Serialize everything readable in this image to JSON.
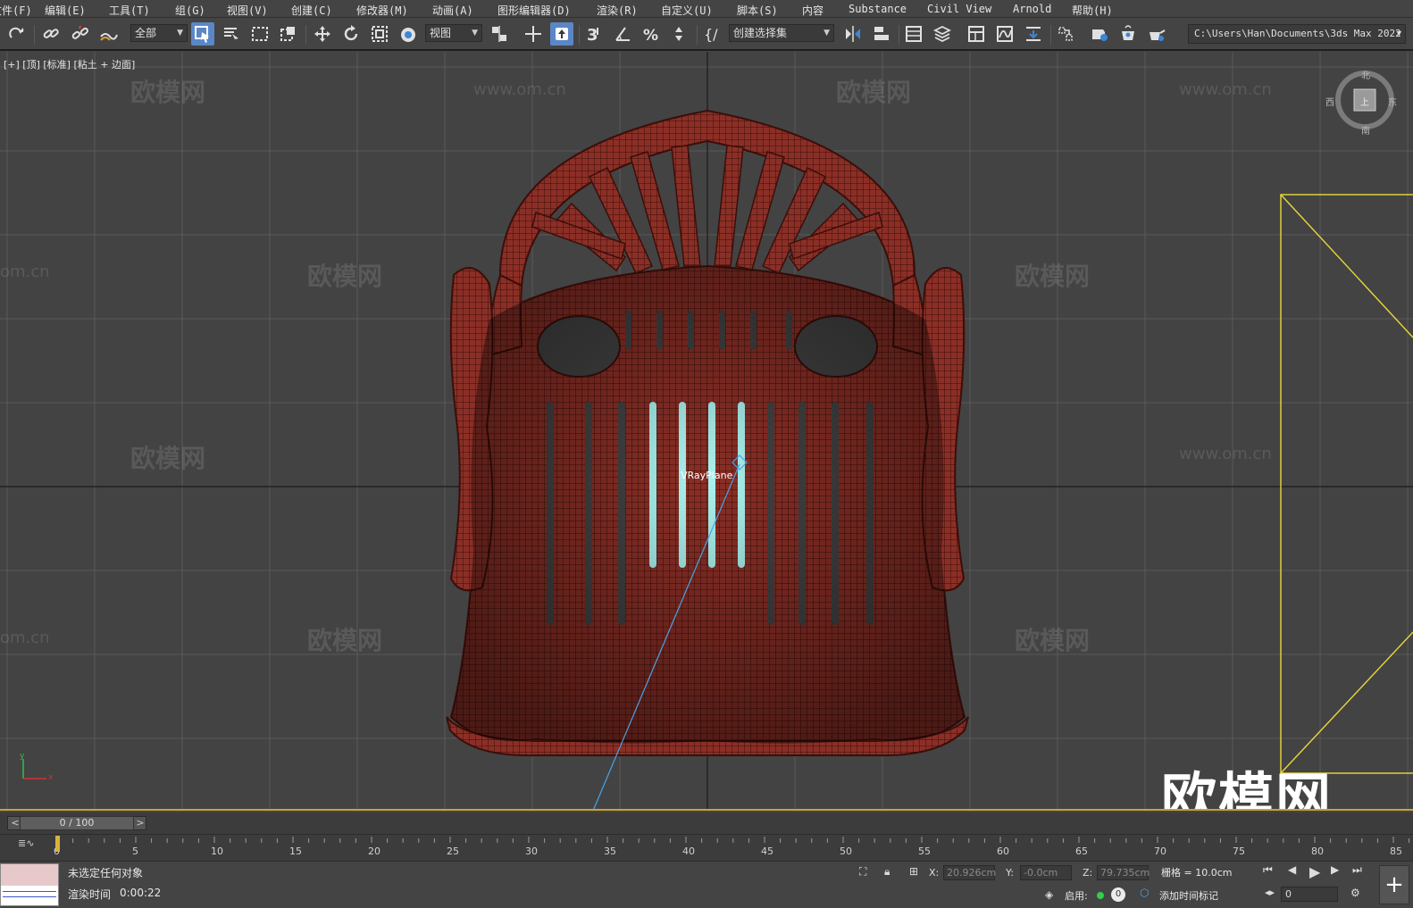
{
  "menu": [
    "文件(F)",
    "编辑(E)",
    "工具(T)",
    "组(G)",
    "视图(V)",
    "创建(C)",
    "修改器(M)",
    "动画(A)",
    "图形编辑器(D)",
    "渲染(R)",
    "自定义(U)",
    "脚本(S)",
    "内容",
    "Substance",
    "Civil View",
    "Arnold",
    "帮助(H)"
  ],
  "toolbar": {
    "filter_dropdown": "全部",
    "coord_dropdown": "视图",
    "selection_set_dropdown": "创建选择集",
    "snap_label": "3",
    "project_path": "C:\\Users\\Han\\Documents\\3ds Max 2022"
  },
  "viewport": {
    "label": "[+] [顶] [标准] [粘土 + 边面]",
    "object_label": "VRayPlane",
    "watermark_text": "欧模网",
    "watermark_url": "www.om.cn",
    "watermark_url_partial": "om.cn",
    "logo_text": "欧模网",
    "viewcube": {
      "north": "北",
      "south": "南",
      "east": "东",
      "west": "西",
      "face": "上"
    },
    "axis_y": "y",
    "axis_x": "x",
    "colors": {
      "model": "#7a2a22",
      "glass": "#a9f3ef",
      "grid": "#5a5a5a",
      "camera": "#e9d83a",
      "target_line": "#4aa3e8"
    }
  },
  "timeline": {
    "frame_display": "0 / 100",
    "current_frame": 0,
    "total_frames": 100,
    "tick_labels": [
      "0",
      "5",
      "10",
      "15",
      "20",
      "25",
      "30",
      "35",
      "40",
      "45",
      "50",
      "55",
      "60",
      "65",
      "70",
      "75",
      "80",
      "85"
    ]
  },
  "status": {
    "selection_text": "未选定任何对象",
    "render_time_label": "渲染时间",
    "render_time_value": "0:00:22",
    "x_label": "X:",
    "x_value": "20.926cm",
    "y_label": "Y:",
    "y_value": "-0.0cm",
    "z_label": "Z:",
    "z_value": "79.735cm",
    "grid_text": "栅格 = 10.0cm",
    "enable_label": "启用:",
    "enable_count": "0",
    "add_time_tag": "添加时间标记",
    "frame_field": "0"
  }
}
